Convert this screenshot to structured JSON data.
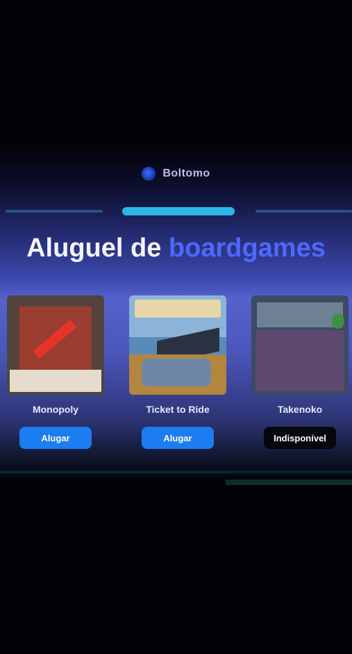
{
  "brand": {
    "name": "Boltomo",
    "icon": "brand-logo-icon"
  },
  "carousel": {
    "indicator_count": 3,
    "active_index": 1
  },
  "title": {
    "part1": "Aluguel de",
    "part2": "boardgames"
  },
  "colors": {
    "accent": "#4d68ff",
    "button_primary": "#1c7df0",
    "indicator_active": "#2bb6e8"
  },
  "games": [
    {
      "name": "Monopoly",
      "button": "Alugar"
    },
    {
      "name": "Ticket to Ride",
      "button": "Alugar"
    },
    {
      "name": "Takenoko",
      "button": "Indisponível"
    }
  ]
}
